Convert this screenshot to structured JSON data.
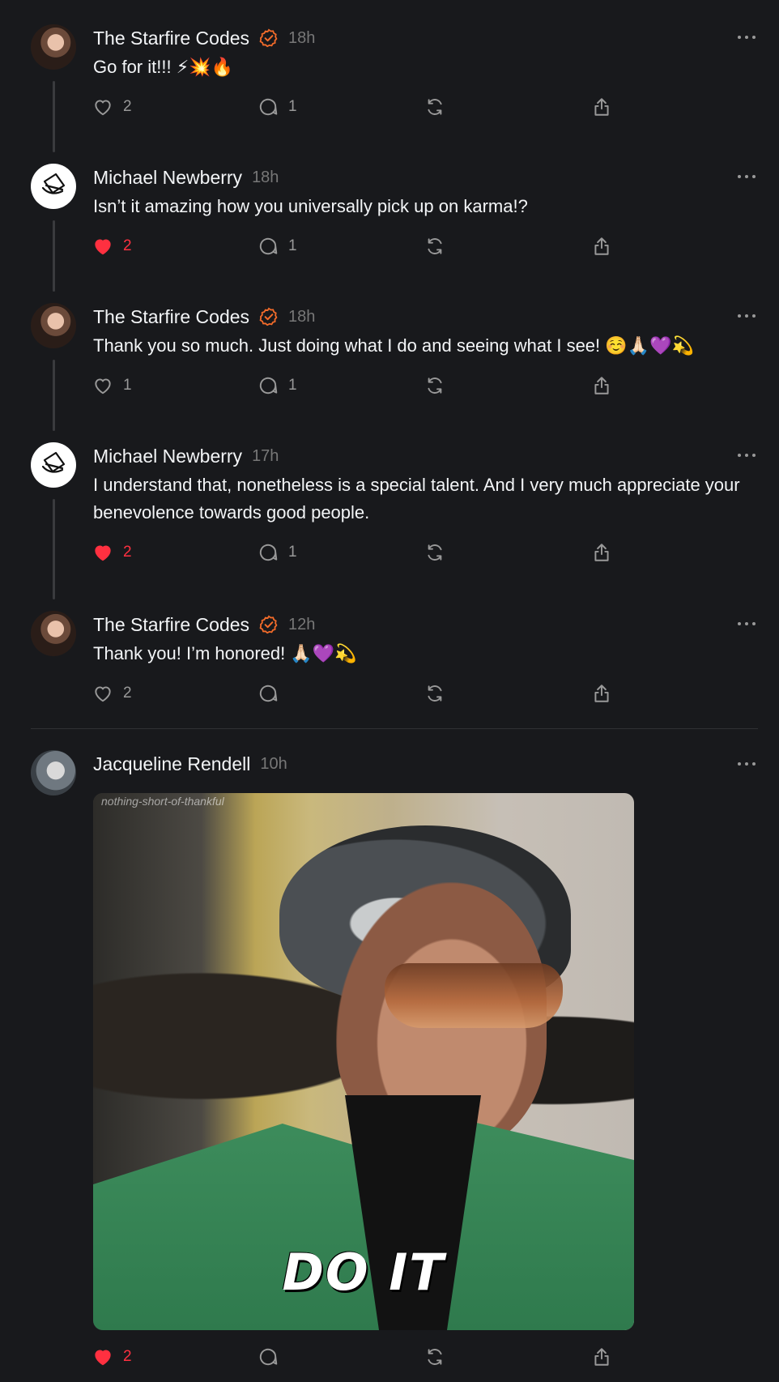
{
  "posts": [
    {
      "author": "The Starfire Codes",
      "verified": true,
      "time": "18h",
      "text": "Go for it!!! ⚡💥🔥",
      "likes": "2",
      "liked": false,
      "replies": "1"
    },
    {
      "author": "Michael Newberry",
      "verified": false,
      "time": "18h",
      "text": "Isn’t it amazing how you universally pick up on karma!?",
      "likes": "2",
      "liked": true,
      "replies": "1"
    },
    {
      "author": "The Starfire Codes",
      "verified": true,
      "time": "18h",
      "text": "Thank you so much. Just doing what I do and seeing what I see! ☺️🙏🏻💜💫",
      "likes": "1",
      "liked": false,
      "replies": "1"
    },
    {
      "author": "Michael Newberry",
      "verified": false,
      "time": "17h",
      "text": "I understand that, nonetheless is a special talent. And I very much appreciate your benevolence towards good people.",
      "likes": "2",
      "liked": true,
      "replies": "1"
    },
    {
      "author": "The Starfire Codes",
      "verified": true,
      "time": "12h",
      "text": "Thank you! I’m honored! 🙏🏻💜💫",
      "likes": "2",
      "liked": false,
      "replies": ""
    },
    {
      "author": "Jacqueline Rendell",
      "verified": false,
      "time": "10h",
      "media": {
        "watermark": "nothing-short-of-thankful",
        "caption": "DO IT"
      },
      "likes": "2",
      "liked": true,
      "replies": ""
    }
  ],
  "colors": {
    "background": "#18191c",
    "text": "#f3f5f7",
    "muted": "#777777",
    "count": "#999999",
    "like_active": "#ff3040",
    "verified": "#f26b2a"
  },
  "icons": [
    "verified-badge-icon",
    "more-icon",
    "heart-icon",
    "comment-icon",
    "repost-icon",
    "share-icon"
  ]
}
